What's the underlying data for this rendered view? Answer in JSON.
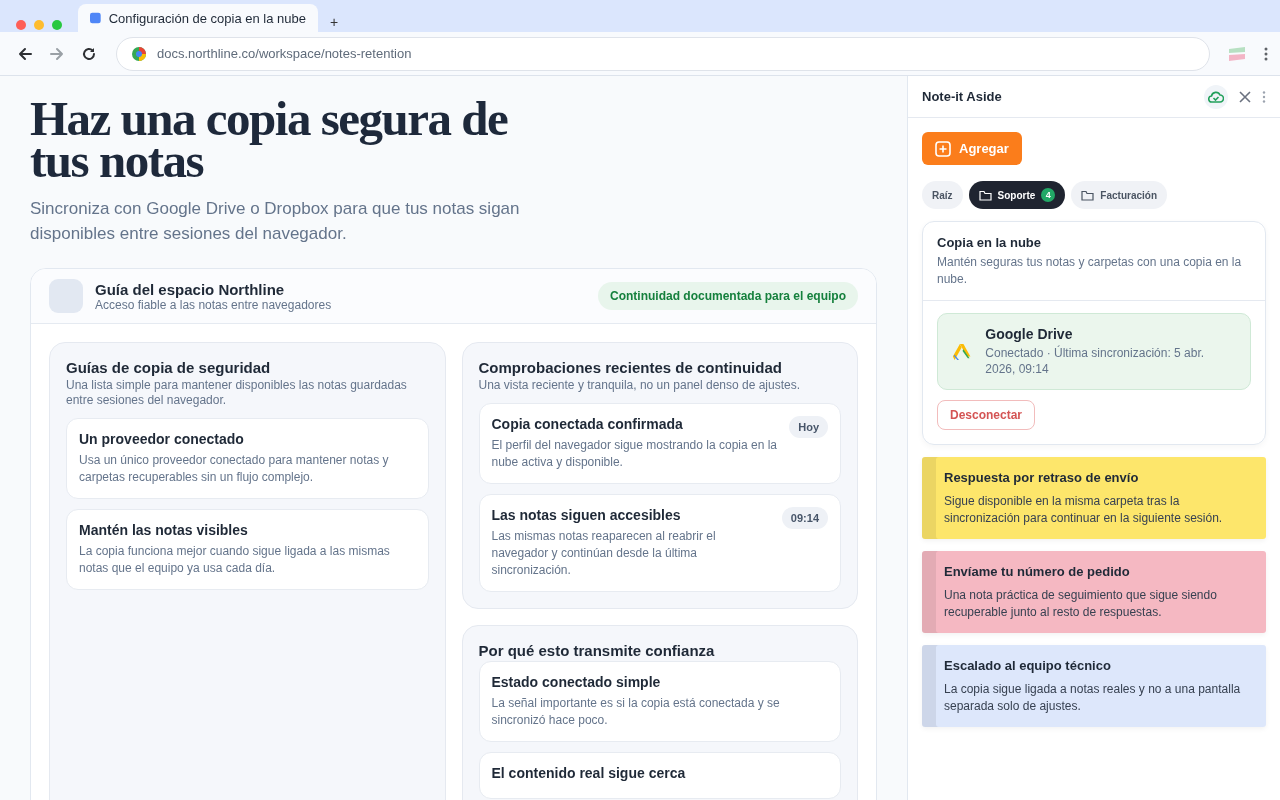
{
  "browser": {
    "tabs": [
      {
        "title": "Configuración de copia en la nube",
        "selected": true
      }
    ],
    "new_tab": "+",
    "nav": [
      {
        "kind": "back",
        "disabled": false
      },
      {
        "kind": "forward",
        "disabled": true
      },
      {
        "kind": "reload",
        "disabled": false
      }
    ],
    "url": "docs.northline.co/workspace/notes-retention"
  },
  "page": {
    "title": "Haz una copia segura de tus notas",
    "subtitle": "Sincroniza con Google Drive o Dropbox para que tus notas sigan disponibles entre sesiones del navegador.",
    "guide": {
      "title": "Guía del espacio Northline",
      "subtitle": "Acceso fiable a las notas entre navegadores",
      "badge": "Continuidad documentada para el equipo",
      "columns": [
        [
          {
            "title": "Guías de copia de seguridad",
            "subtitle": "Una lista simple para mantener disponibles las notas guardadas entre sesiones del navegador.",
            "items": [
              {
                "title": "Un proveedor conectado",
                "text": "Usa un único proveedor conectado para mantener notas y carpetas recuperables sin un flujo complejo."
              },
              {
                "title": "Mantén las notas visibles",
                "text": "La copia funciona mejor cuando sigue ligada a las mismas notas que el equipo ya usa cada día."
              }
            ]
          }
        ],
        [
          {
            "title": "Comprobaciones recientes de continuidad",
            "subtitle": "Una vista reciente y tranquila, no un panel denso de ajustes.",
            "items": [
              {
                "title": "Copia conectada confirmada",
                "text": "El perfil del navegador sigue mostrando la copia en la nube activa y disponible.",
                "tag": "Hoy"
              },
              {
                "title": "Las notas siguen accesibles",
                "text": "Las mismas notas reaparecen al reabrir el navegador y continúan desde la última sincronización.",
                "tag": "09:14"
              }
            ]
          },
          {
            "title": "Por qué esto transmite confianza",
            "items": [
              {
                "title": "Estado conectado simple",
                "text": "La señal importante es si la copia está conectada y se sincronizó hace poco."
              },
              {
                "title": "El contenido real sigue cerca"
              }
            ]
          }
        ]
      ]
    }
  },
  "panel": {
    "title": "Note-it Aside",
    "synced": true,
    "add_button": "Agregar",
    "folders": [
      {
        "kind": "root",
        "label": "Raíz",
        "selected": false
      },
      {
        "kind": "folder",
        "label": "Soporte",
        "count": "4",
        "selected": true
      },
      {
        "kind": "folder",
        "label": "Facturación",
        "selected": false
      }
    ],
    "backup": {
      "title": "Copia en la nube",
      "text": "Mantén seguras tus notas y carpetas con una copia en la nube.",
      "provider": {
        "name": "Google Drive",
        "status": "Conectado · Última sincronización: 5 abr. 2026, 09:14",
        "connected": true
      },
      "disconnect": "Desconectar"
    },
    "notes": [
      {
        "title": "Respuesta por retraso de envío",
        "text": "Sigue disponible en la misma carpeta tras la sincronización para continuar en la siguiente sesión.",
        "color": "#fde66b"
      },
      {
        "title": "Envíame tu número de pedido",
        "text": "Una nota práctica de seguimiento que sigue siendo recuperable junto al resto de respuestas.",
        "color": "#f5b8c2"
      },
      {
        "title": "Escalado al equipo técnico",
        "text": "La copia sigue ligada a notas reales y no a una pantalla separada solo de ajustes.",
        "color": "#dde7fb"
      }
    ]
  }
}
